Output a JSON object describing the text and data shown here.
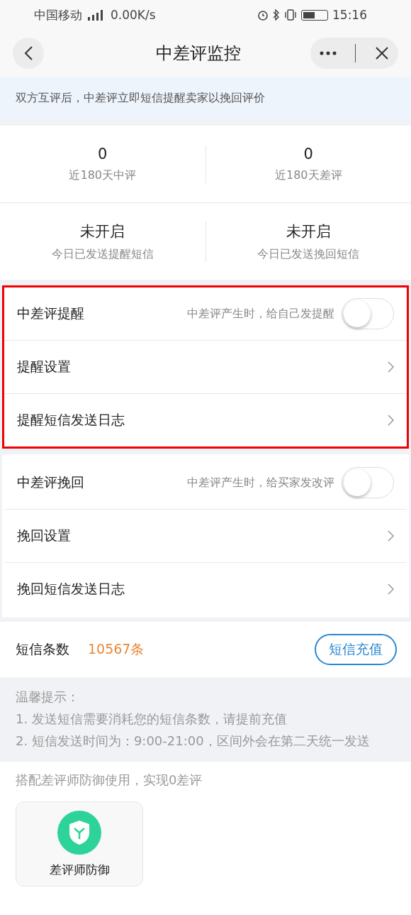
{
  "status_bar": {
    "carrier": "中国移动",
    "speed": "0.00K/s",
    "time": "15:16",
    "battery": {
      "level": 0.5
    }
  },
  "nav": {
    "title": "中差评监控"
  },
  "notice": "双方互评后，中差评立即短信提醒卖家以挽回评价",
  "stats": [
    [
      {
        "value": "0",
        "label": "近180天中评"
      },
      {
        "value": "0",
        "label": "近180天差评"
      }
    ],
    [
      {
        "value": "未开启",
        "label": "今日已发送提醒短信"
      },
      {
        "value": "未开启",
        "label": "今日已发送挽回短信"
      }
    ]
  ],
  "sections": [
    {
      "highlighted": true,
      "rows": [
        {
          "kind": "toggle",
          "label": "中差评提醒",
          "hint": "中差评产生时，给自己发提醒",
          "on": false
        },
        {
          "kind": "link",
          "label": "提醒设置"
        },
        {
          "kind": "link",
          "label": "提醒短信发送日志"
        }
      ]
    },
    {
      "highlighted": false,
      "rows": [
        {
          "kind": "toggle",
          "label": "中差评挽回",
          "hint": "中差评产生时，给买家发改评",
          "on": false
        },
        {
          "kind": "link",
          "label": "挽回设置"
        },
        {
          "kind": "link",
          "label": "挽回短信发送日志"
        }
      ]
    }
  ],
  "sms": {
    "label": "短信条数",
    "count": "10567条",
    "button": "短信充值"
  },
  "tips": [
    "温馨提示：",
    "1. 发送短信需要消耗您的短信条数，请提前充值",
    "2. 短信发送时间为：9:00-21:00，区间外会在第二天统一发送"
  ],
  "promo": {
    "text": "搭配差评师防御使用，实现0差评",
    "cards": [
      {
        "label": "差评师防御"
      }
    ]
  }
}
